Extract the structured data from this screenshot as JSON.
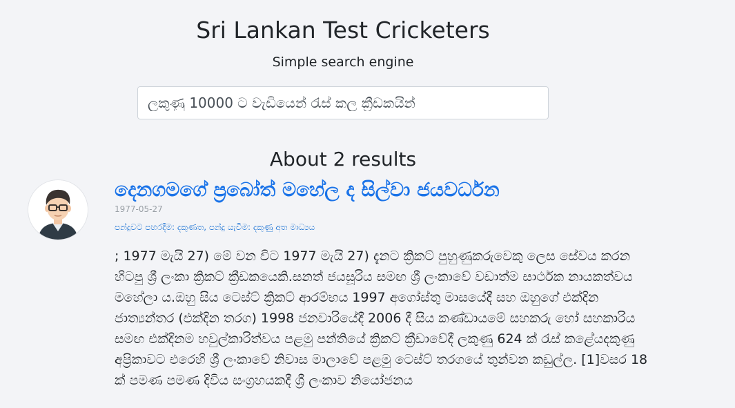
{
  "header": {
    "title": "Sri Lankan Test Cricketers",
    "subtitle": "Simple search engine"
  },
  "search": {
    "value": "ලකුණු 10000 ට වැඩියෙන් රැස් කල ක්‍රීඩකයින්",
    "placeholder": ""
  },
  "results": {
    "count_label": "About 2 results",
    "items": [
      {
        "avatar_icon": "person-avatar-icon",
        "title": "දෙනගමගේ ප්‍රබෝත් මහේල ද සිල්වා ජයවර්ධන",
        "date": "1977-05-27",
        "meta": "පන්දුවට පහරදීම: දකුණත, පන්දු යැවීම: දකුණු අත මාධ්‍යය",
        "body": "; 1977 මැයි 27) මේ වන විට 1977 මැයි 27) දැනට ක්‍රිකට් පුහුණුකරුවෙකු ලෙස සේවය කරන හිටපු ශ්‍රී ලංකා ක්‍රිකට් ක්‍රීඩකයෙකි.සනත් ජයසූරිය සමඟ ශ්‍රී ලංකාවේ වඩාත්ම සාර්ථක නායකත්වය මහේලා ය.ඔහු සිය ටෙස්ට් ක්‍රිකට් ආරම්භය 1997 අගෝස්තු මාසයේදී සහ ඔහුගේ එක්දින ජාත්‍යන්තර (එක්දින තරග) 1998 ජනවාරියේදී 2006 දී සිය කණ්ඩායමේ සහකරු හෝ සහකාරිය සමඟ එක්දිනම හවුල්කාරිත්වය පළමු පන්තියේ ක්‍රිකට් ක්‍රීඩාවේදී ලකුණු 624 ක් රැස් කළේයදකුණු අප්‍රිකාවට එරෙහි ශ්‍රී ලංකාවේ නිවාස මාලාවේ පළමු ටෙස්ට් තරගයේ තුන්වන කඩුල්ල. [1]වසර 18 ක් පමණ පමණ දිවිය සංග්‍රහයකදී ශ්‍රී ලංකාව නියෝජනය"
      }
    ]
  },
  "colors": {
    "background": "#f3f4f7",
    "link": "#1a73e8",
    "meta": "#2a7bd6",
    "date": "#9aa0a6"
  }
}
